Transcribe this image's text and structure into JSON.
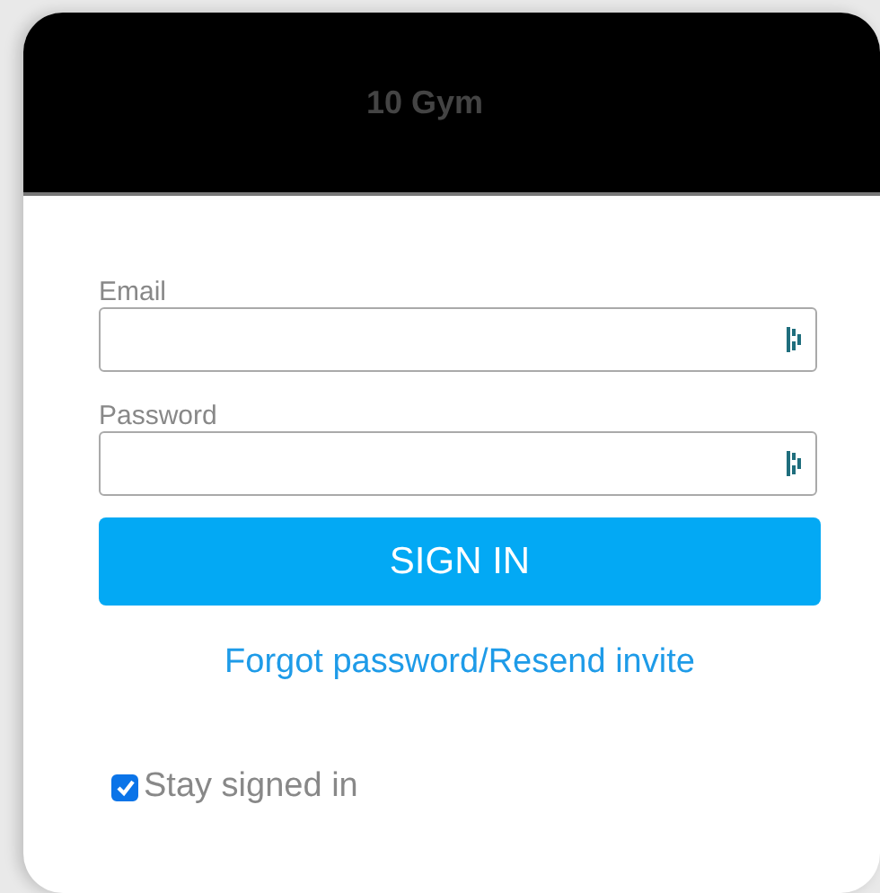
{
  "header": {
    "title": "10 Gym"
  },
  "fields": [
    {
      "label": "Email"
    },
    {
      "label": "Password"
    }
  ],
  "sign_in_button": "SIGN IN",
  "link": "Forgot password/Resend invite",
  "stay_signed_in": {
    "label": "Stay signed in",
    "checked": true
  }
}
